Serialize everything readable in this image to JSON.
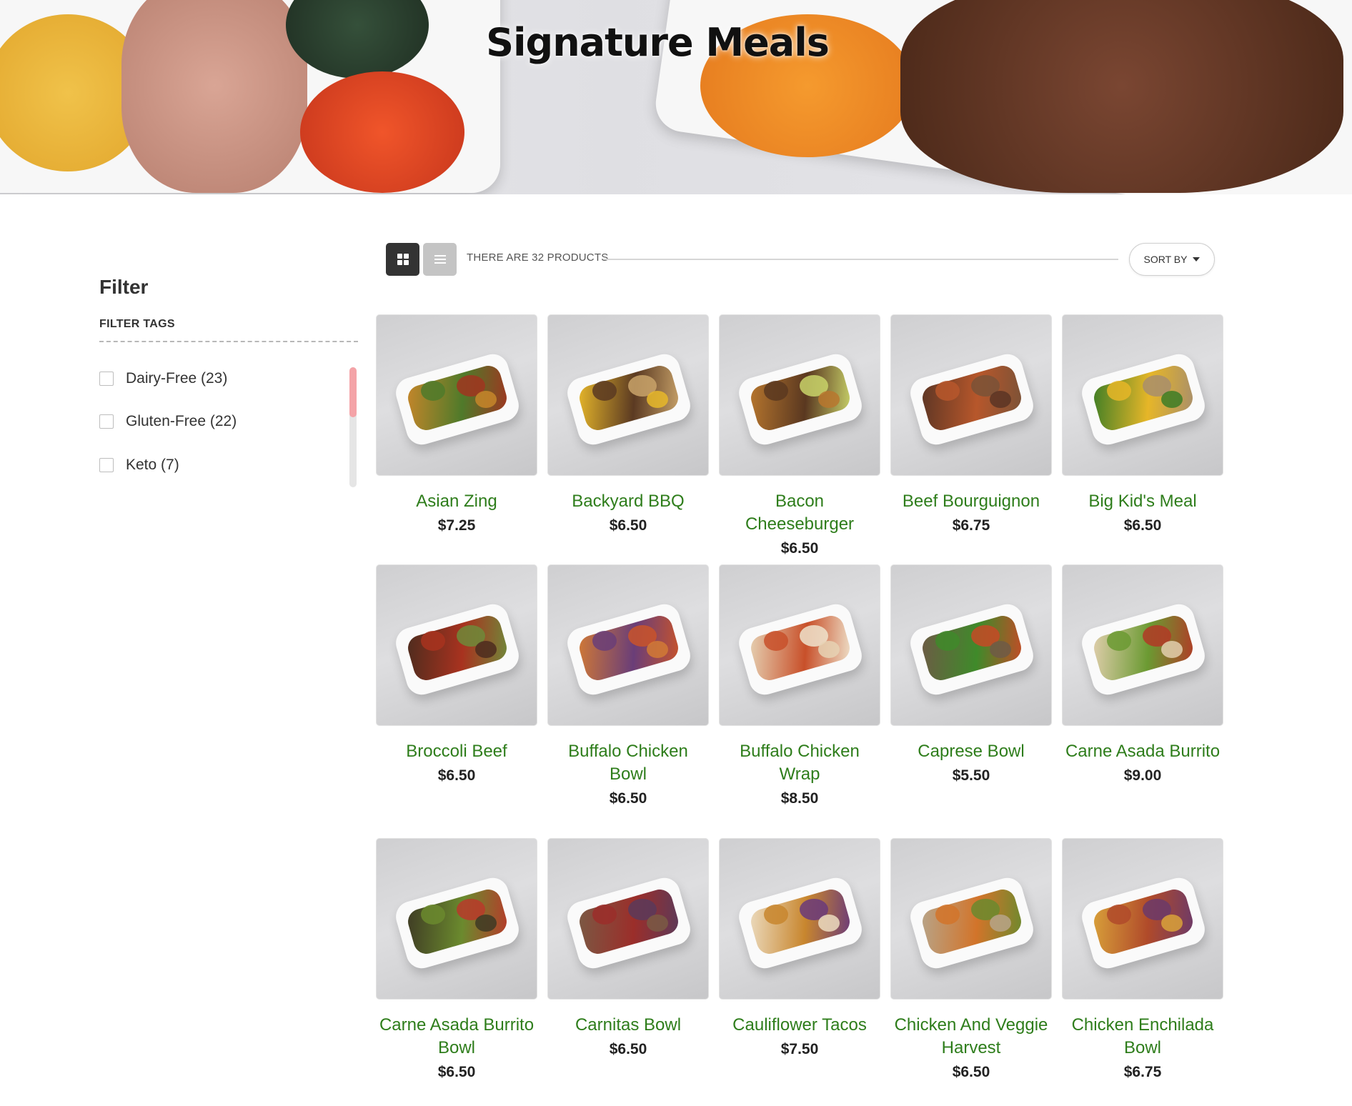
{
  "hero": {
    "title": "Signature Meals"
  },
  "sidebar": {
    "title": "Filter",
    "tags_heading": "FILTER TAGS",
    "facets": [
      {
        "label": "Dairy-Free (23)",
        "checked": false
      },
      {
        "label": "Gluten-Free (22)",
        "checked": false
      },
      {
        "label": "Keto (7)",
        "checked": false
      }
    ]
  },
  "toolbar": {
    "grid_icon": "grid-view-icon",
    "list_icon": "list-view-icon",
    "count_text": "THERE ARE 32 PRODUCTS",
    "sort_label": "SORT BY"
  },
  "products": [
    {
      "name": "Asian Zing",
      "price": "$7.25",
      "colors": [
        "#c7862a",
        "#4f7a2a",
        "#a03520"
      ]
    },
    {
      "name": "Backyard BBQ",
      "price": "$6.50",
      "colors": [
        "#e8b82a",
        "#5b3a22",
        "#c9a36a"
      ]
    },
    {
      "name": "Bacon Cheeseburger",
      "price": "$6.50",
      "colors": [
        "#b8772e",
        "#5a3820",
        "#c9d36a"
      ]
    },
    {
      "name": "Beef Bourguignon",
      "price": "$6.75",
      "colors": [
        "#5b3524",
        "#b7572b",
        "#7a5237"
      ]
    },
    {
      "name": "Big Kid's Meal",
      "price": "$6.50",
      "colors": [
        "#3c7d26",
        "#e6b628",
        "#a88e6c"
      ]
    },
    {
      "name": "Broccoli Beef",
      "price": "$6.50",
      "colors": [
        "#4c2c1e",
        "#a8321f",
        "#6f8a3a"
      ]
    },
    {
      "name": "Buffalo Chicken Bowl",
      "price": "$6.50",
      "colors": [
        "#d27a35",
        "#6a3e78",
        "#c9542a"
      ]
    },
    {
      "name": "Buffalo Chicken Wrap",
      "price": "$8.50",
      "colors": [
        "#e6d2b4",
        "#c8502a",
        "#efe3cc"
      ]
    },
    {
      "name": "Caprese Bowl",
      "price": "$5.50",
      "colors": [
        "#6e5a46",
        "#3f8a2a",
        "#c64a26"
      ]
    },
    {
      "name": "Carne Asada Burrito",
      "price": "$9.00",
      "colors": [
        "#e2cfae",
        "#6b9a32",
        "#b23a26"
      ]
    },
    {
      "name": "Carne Asada Burrito Bowl",
      "price": "$6.50",
      "colors": [
        "#3e3a24",
        "#6b8a2e",
        "#b8392a"
      ]
    },
    {
      "name": "Carnitas Bowl",
      "price": "$6.50",
      "colors": [
        "#7a5a44",
        "#9b2e2a",
        "#5b3a5a"
      ]
    },
    {
      "name": "Cauliflower Tacos",
      "price": "$7.50",
      "colors": [
        "#ecdcc0",
        "#c8862e",
        "#6a3a7a"
      ]
    },
    {
      "name": "Chicken And Veggie Harvest",
      "price": "$6.50",
      "colors": [
        "#b7a58a",
        "#d2742a",
        "#6b8a2e"
      ]
    },
    {
      "name": "Chicken Enchilada Bowl",
      "price": "$6.75",
      "colors": [
        "#d9a23a",
        "#b04a2a",
        "#6b3a6a"
      ]
    }
  ]
}
